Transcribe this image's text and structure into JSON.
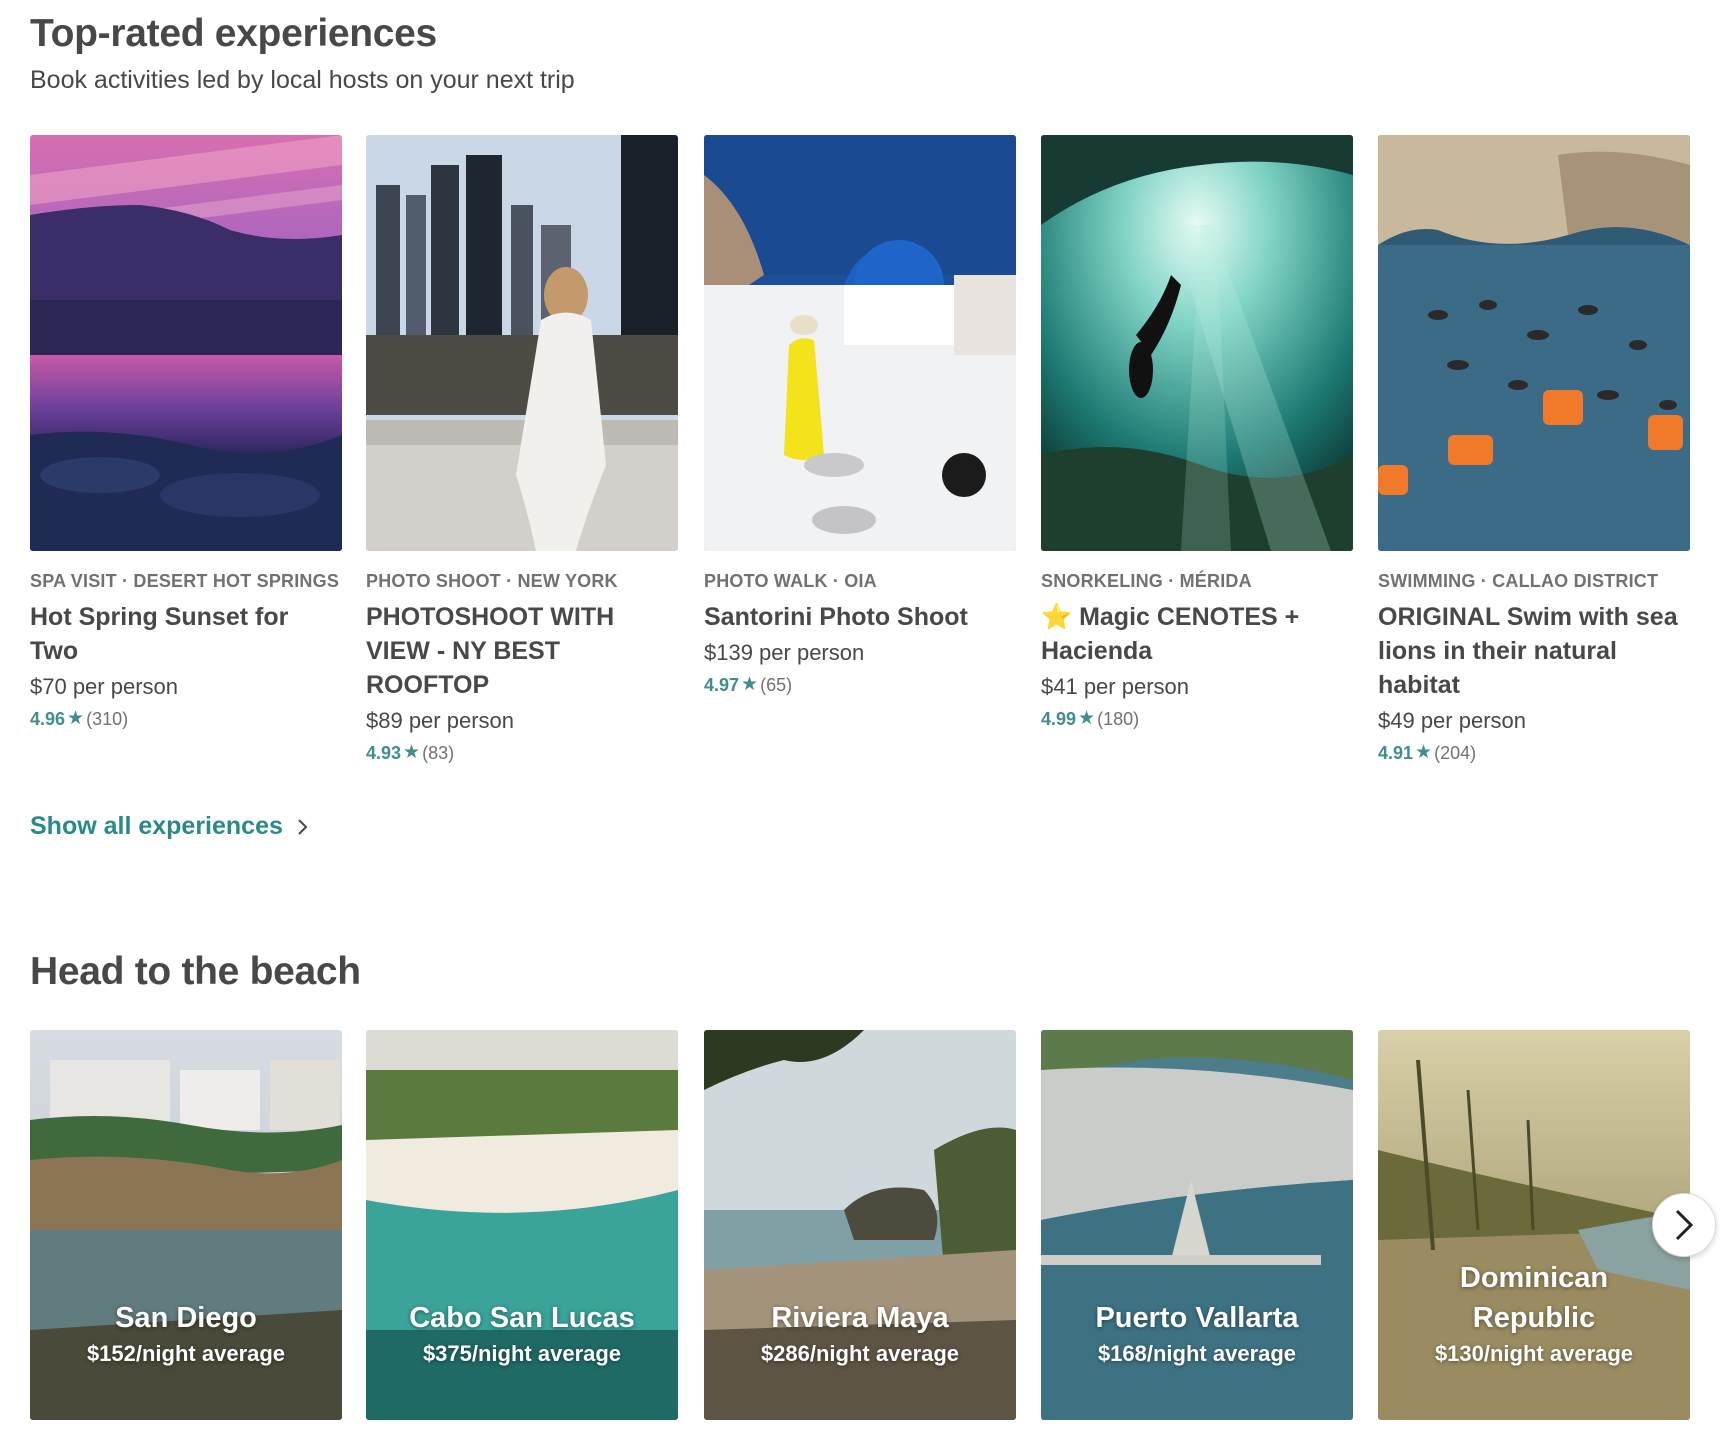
{
  "experiences_section": {
    "title": "Top-rated experiences",
    "subtitle": "Book activities led by local hosts on your next trip",
    "show_all_label": "Show all experiences",
    "cards": [
      {
        "category": "SPA VISIT · DESERT HOT SPRINGS",
        "title": "Hot Spring Sunset for Two",
        "price": "$70 per person",
        "rating": "4.96",
        "reviews": "(310)"
      },
      {
        "category": "PHOTO SHOOT · NEW YORK",
        "title": "PHOTOSHOOT WITH VIEW - NY BEST ROOFTOP",
        "price": "$89 per person",
        "rating": "4.93",
        "reviews": "(83)"
      },
      {
        "category": "PHOTO WALK · OIA",
        "title": "Santorini Photo Shoot",
        "price": "$139 per person",
        "rating": "4.97",
        "reviews": "(65)"
      },
      {
        "category": "SNORKELING · MÉRIDA",
        "title": "⭐ Magic CENOTES + Hacienda",
        "price": "$41 per person",
        "rating": "4.99",
        "reviews": "(180)"
      },
      {
        "category": "SWIMMING · CALLAO DISTRICT",
        "title": "ORIGINAL Swim with sea lions in their natural habitat",
        "price": "$49 per person",
        "rating": "4.91",
        "reviews": "(204)"
      }
    ]
  },
  "beach_section": {
    "title": "Head to the beach",
    "cards": [
      {
        "name": "San Diego",
        "price": "$152/night average"
      },
      {
        "name": "Cabo San Lucas",
        "price": "$375/night average"
      },
      {
        "name": "Riviera Maya",
        "price": "$286/night average"
      },
      {
        "name": "Puerto Vallarta",
        "price": "$168/night average"
      },
      {
        "name": "Dominican Republic",
        "price": "$130/night average"
      }
    ]
  },
  "icons": {
    "star": "star-icon",
    "chevron": "chevron-right-icon",
    "next": "next-arrow-icon"
  },
  "colors": {
    "accent": "#3f8d8d",
    "text": "#484848",
    "muted": "#717171"
  }
}
